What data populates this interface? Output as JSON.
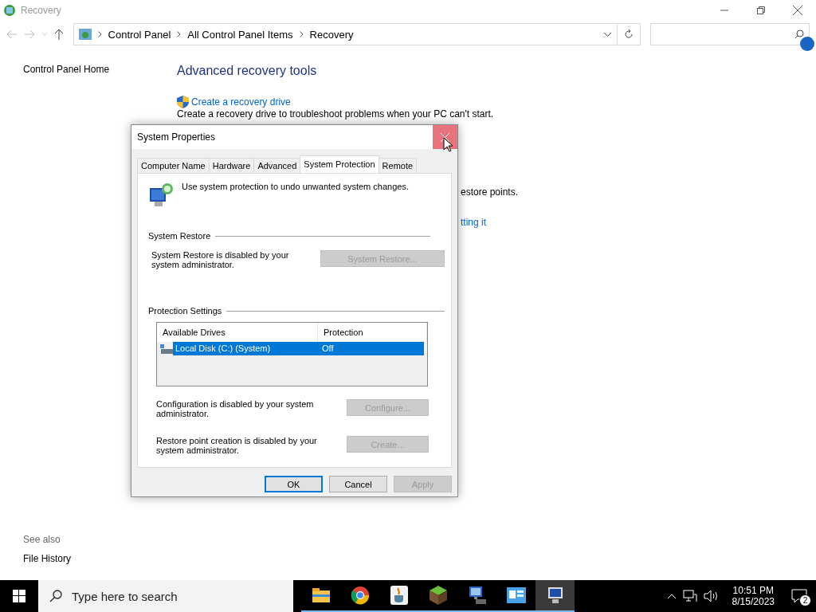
{
  "window": {
    "title": "Recovery"
  },
  "address_bar": {
    "path": [
      "Control Panel",
      "All Control Panel Items",
      "Recovery"
    ]
  },
  "sidebar": {
    "items": [
      "Control Panel Home"
    ],
    "see_also_title": "See also",
    "see_also": [
      "File History"
    ]
  },
  "content": {
    "heading": "Advanced recovery tools",
    "link": "Create a recovery drive",
    "description": "Create a recovery drive to troubleshoot problems when your PC can't start.",
    "fragments": [
      "estore points.",
      "tting it"
    ]
  },
  "dialog": {
    "title": "System Properties",
    "close_hovered": true,
    "tabs": [
      {
        "label": "Computer Name",
        "selected": false
      },
      {
        "label": "Hardware",
        "selected": false
      },
      {
        "label": "Advanced",
        "selected": false
      },
      {
        "label": "System Protection",
        "selected": true
      },
      {
        "label": "Remote",
        "selected": false
      }
    ],
    "intro": "Use system protection to undo unwanted system changes.",
    "system_restore": {
      "title": "System Restore",
      "text": "System Restore is disabled by your system administrator.",
      "button": {
        "label": "System Restore...",
        "disabled": true
      }
    },
    "protection": {
      "title": "Protection Settings",
      "columns": [
        "Available Drives",
        "Protection"
      ],
      "rows": [
        {
          "drive": "Local Disk (C:) (System)",
          "protection": "Off",
          "selected": true
        }
      ],
      "settings": [
        {
          "text": "Configuration is disabled by your system administrator.",
          "button": {
            "label": "Configure...",
            "disabled": true
          }
        },
        {
          "text": "Restore point creation is disabled by your system administrator.",
          "button": {
            "label": "Create...",
            "disabled": true
          }
        }
      ]
    },
    "buttons": [
      {
        "label": "OK",
        "kind": "default",
        "disabled": false
      },
      {
        "label": "Cancel",
        "kind": "normal",
        "disabled": false
      },
      {
        "label": "Apply",
        "kind": "normal",
        "disabled": true
      }
    ]
  },
  "taskbar": {
    "search_placeholder": "Type here to search",
    "apps": [
      {
        "kind": "folder",
        "active": false
      },
      {
        "kind": "browser",
        "active": false
      },
      {
        "kind": "cup",
        "active": false
      },
      {
        "kind": "block",
        "active": false
      },
      {
        "kind": "monitor",
        "active": false
      },
      {
        "kind": "panel",
        "active": false
      },
      {
        "kind": "computer",
        "active": true
      }
    ],
    "time": "10:51 PM",
    "date": "8/15/2023",
    "notification_count": "2"
  }
}
